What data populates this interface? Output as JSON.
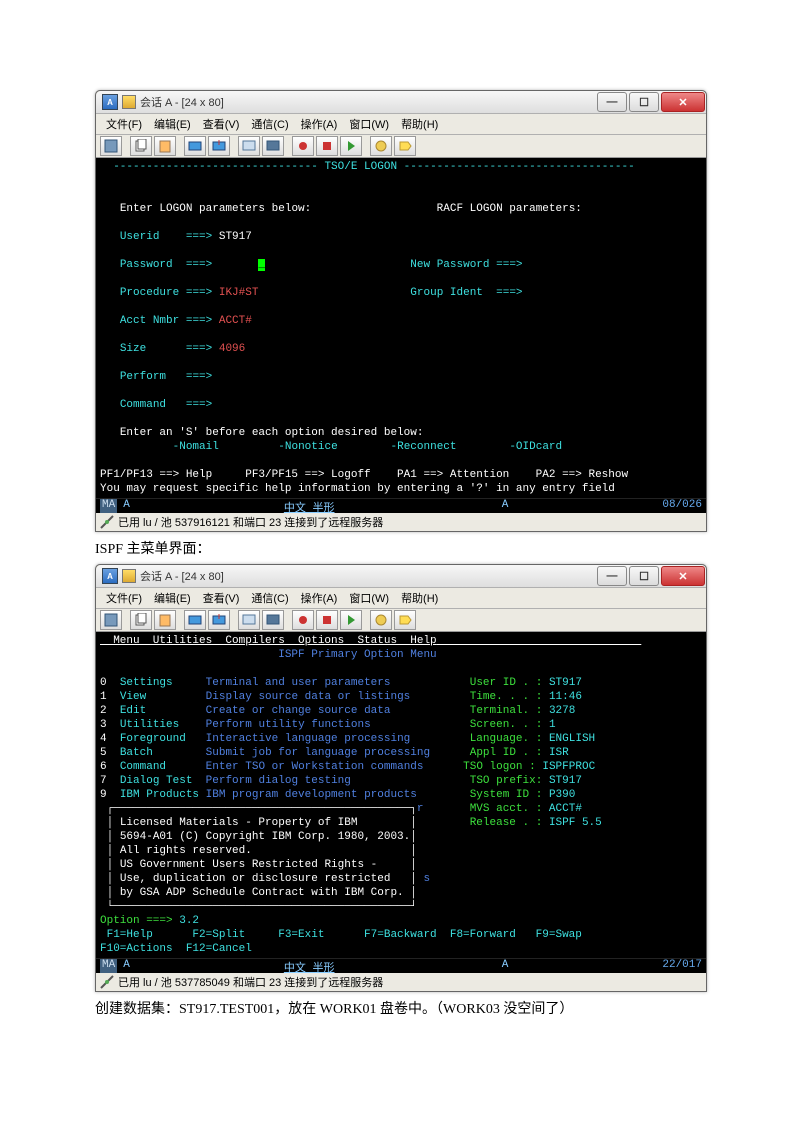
{
  "window_title": "会话 A - [24 x 80]",
  "menu": [
    "文件(F)",
    "编辑(E)",
    "查看(V)",
    "通信(C)",
    "操作(A)",
    "窗口(W)",
    "帮助(H)"
  ],
  "logon": {
    "header": "TSO/E LOGON",
    "prompt": "Enter LOGON parameters below:",
    "racf": "RACF LOGON parameters:",
    "userid_l": "Userid",
    "userid_v": "ST917",
    "password_l": "Password",
    "newpass_l": "New Password",
    "procedure_l": "Procedure",
    "procedure_v": "IKJ#ST",
    "group_l": "Group Ident",
    "acct_l": "Acct Nmbr",
    "acct_v": "ACCT#",
    "size_l": "Size",
    "size_v": "4096",
    "perform_l": "Perform",
    "command_l": "Command",
    "opts_prompt": "Enter an 'S' before each option desired below:",
    "opt_nomail": "-Nomail",
    "opt_nonotice": "-Nonotice",
    "opt_reconnect": "-Reconnect",
    "opt_oidcard": "-OIDcard",
    "pf_line": "PF1/PF13 ==> Help     PF3/PF15 ==> Logoff    PA1 ==> Attention    PA2 ==> Reshow",
    "help_line": "You may request specific help information by entering a '?' in any entry field",
    "ime": "中文 半形",
    "status_pos": "08/026",
    "foot": "已用 lu / 池 537916121 和端口 23 连接到了远程服务器"
  },
  "caption1": "ISPF 主菜单界面：",
  "ispf": {
    "menubar": "  Menu  Utilities  Compilers  Options  Status  Help",
    "title": "ISPF Primary Option Menu",
    "rows": [
      {
        "n": "0",
        "name": "Settings",
        "desc": "Terminal and user parameters",
        "rlabel": "User ID . :",
        "rval": "ST917"
      },
      {
        "n": "1",
        "name": "View",
        "desc": "Display source data or listings",
        "rlabel": "Time. . . :",
        "rval": "11:46"
      },
      {
        "n": "2",
        "name": "Edit",
        "desc": "Create or change source data",
        "rlabel": "Terminal. :",
        "rval": "3278"
      },
      {
        "n": "3",
        "name": "Utilities",
        "desc": "Perform utility functions",
        "rlabel": "Screen. . :",
        "rval": "1"
      },
      {
        "n": "4",
        "name": "Foreground",
        "desc": "Interactive language processing",
        "rlabel": "Language. :",
        "rval": "ENGLISH"
      },
      {
        "n": "5",
        "name": "Batch",
        "desc": "Submit job for language processing",
        "rlabel": "Appl ID . :",
        "rval": "ISR"
      },
      {
        "n": "6",
        "name": "Command",
        "desc": "Enter TSO or Workstation commands",
        "rlabel": "TSO logon :",
        "rval": "ISPFPROC"
      },
      {
        "n": "7",
        "name": "Dialog Test",
        "desc": "Perform dialog testing",
        "rlabel": "TSO prefix:",
        "rval": "ST917"
      },
      {
        "n": "9",
        "name": "IBM Products",
        "desc": "IBM program development products",
        "rlabel": "System ID :",
        "rval": "P390"
      }
    ],
    "extra_r1": {
      "suffix": "r",
      "rlabel": "MVS acct. :",
      "rval": "ACCT#"
    },
    "extra_r2": {
      "rlabel": "Release . :",
      "rval": "ISPF 5.5"
    },
    "box": [
      "Licensed Materials - Property of IBM",
      "5694-A01 (C) Copyright IBM Corp. 1980, 2003.",
      "All rights reserved.",
      "US Government Users Restricted Rights -",
      "Use, duplication or disclosure restricted",
      "by GSA ADP Schedule Contract with IBM Corp."
    ],
    "box_suffix": "s",
    "option_l": "Option ===>",
    "option_v": "3.2",
    "fkeys1": " F1=Help      F2=Split     F3=Exit      F7=Backward  F8=Forward   F9=Swap",
    "fkeys2": "F10=Actions  F12=Cancel",
    "ime": "中文 半形",
    "status_pos": "22/017",
    "foot": "已用 lu / 池 537785049 和端口 23 连接到了远程服务器"
  },
  "caption2": "创建数据集：ST917.TEST001，放在 WORK01 盘卷中。（WORK03 没空间了）",
  "arrow": "===>"
}
